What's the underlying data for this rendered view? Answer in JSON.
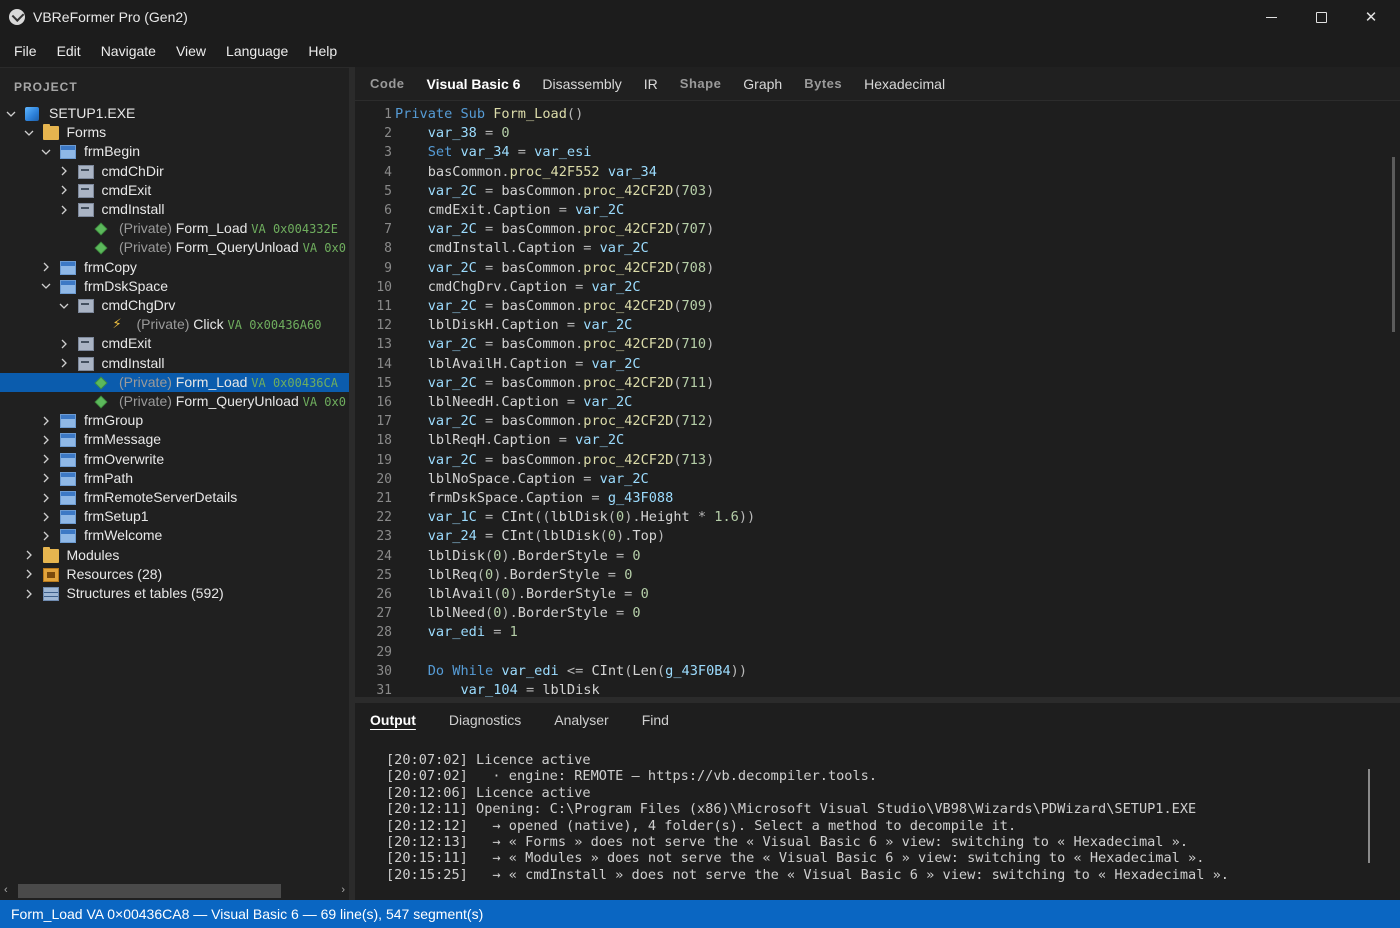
{
  "window": {
    "title": "VBReFormer Pro (Gen2)"
  },
  "menu": [
    "File",
    "Edit",
    "Navigate",
    "View",
    "Language",
    "Help"
  ],
  "project": {
    "header": "PROJECT",
    "tree": [
      {
        "label": "SETUP1.EXE",
        "icon": "exe-icon",
        "expanded": true
      },
      {
        "label": "Forms",
        "icon": "folder-icon",
        "expanded": true
      },
      {
        "label": "frmBegin",
        "icon": "form-icon",
        "expanded": true
      },
      {
        "label": "cmdChDir",
        "icon": "control-icon",
        "expanded": false
      },
      {
        "label": "cmdExit",
        "icon": "control-icon",
        "expanded": false
      },
      {
        "label": "cmdInstall",
        "icon": "control-icon",
        "expanded": false
      },
      {
        "private": "(Private)",
        "label": "Form_Load",
        "va": "VA 0x004332E",
        "icon": "method-icon"
      },
      {
        "private": "(Private)",
        "label": "Form_QueryUnload",
        "va": "VA 0x0",
        "icon": "method-icon"
      },
      {
        "label": "frmCopy",
        "icon": "form-icon",
        "expanded": false
      },
      {
        "label": "frmDskSpace",
        "icon": "form-icon",
        "expanded": true
      },
      {
        "label": "cmdChgDrv",
        "icon": "control-icon",
        "expanded": true
      },
      {
        "private": "(Private)",
        "label": "Click",
        "va": "VA 0x00436A60",
        "icon": "event-bolt-icon"
      },
      {
        "label": "cmdExit",
        "icon": "control-icon",
        "expanded": false
      },
      {
        "label": "cmdInstall",
        "icon": "control-icon",
        "expanded": false
      },
      {
        "private": "(Private)",
        "label": "Form_Load",
        "va": "VA 0x00436CA",
        "icon": "method-icon",
        "selected": true
      },
      {
        "private": "(Private)",
        "label": "Form_QueryUnload",
        "va": "VA 0x0",
        "icon": "method-icon"
      },
      {
        "label": "frmGroup",
        "icon": "form-icon",
        "expanded": false
      },
      {
        "label": "frmMessage",
        "icon": "form-icon",
        "expanded": false
      },
      {
        "label": "frmOverwrite",
        "icon": "form-icon",
        "expanded": false
      },
      {
        "label": "frmPath",
        "icon": "form-icon",
        "expanded": false
      },
      {
        "label": "frmRemoteServerDetails",
        "icon": "form-icon",
        "expanded": false
      },
      {
        "label": "frmSetup1",
        "icon": "form-icon",
        "expanded": false
      },
      {
        "label": "frmWelcome",
        "icon": "form-icon",
        "expanded": false
      },
      {
        "label": "Modules",
        "icon": "folder-icon",
        "expanded": false
      },
      {
        "label": "Resources (28)",
        "icon": "resources-icon",
        "expanded": false
      },
      {
        "label": "Structures et tables (592)",
        "icon": "structures-icon",
        "expanded": false
      }
    ]
  },
  "view_tabs": [
    {
      "label": "Code",
      "caps": true
    },
    {
      "label": "Visual Basic 6",
      "active": true
    },
    {
      "label": "Disassembly"
    },
    {
      "label": "IR"
    },
    {
      "label": "Shape",
      "caps": true
    },
    {
      "label": "Graph"
    },
    {
      "label": "Bytes",
      "caps": true
    },
    {
      "label": "Hexadecimal"
    }
  ],
  "code": {
    "lines": [
      [
        [
          "k",
          "Private Sub "
        ],
        [
          "p",
          "Form_Load"
        ],
        [
          "o",
          "()"
        ]
      ],
      [
        [
          "t",
          "    "
        ],
        [
          "v",
          "var_38"
        ],
        [
          "o",
          " = "
        ],
        [
          "n",
          "0"
        ]
      ],
      [
        [
          "t",
          "    "
        ],
        [
          "k",
          "Set "
        ],
        [
          "v",
          "var_34"
        ],
        [
          "o",
          " = "
        ],
        [
          "v",
          "var_esi"
        ]
      ],
      [
        [
          "t",
          "    basCommon"
        ],
        [
          "o",
          "."
        ],
        [
          "p",
          "proc_42F552"
        ],
        [
          "t",
          " "
        ],
        [
          "v",
          "var_34"
        ]
      ],
      [
        [
          "t",
          "    "
        ],
        [
          "v",
          "var_2C"
        ],
        [
          "o",
          " = "
        ],
        [
          "t",
          "basCommon"
        ],
        [
          "o",
          "."
        ],
        [
          "p",
          "proc_42CF2D"
        ],
        [
          "o",
          "("
        ],
        [
          "n",
          "703"
        ],
        [
          "o",
          ")"
        ]
      ],
      [
        [
          "t",
          "    cmdExit"
        ],
        [
          "o",
          "."
        ],
        [
          "t",
          "Caption"
        ],
        [
          "o",
          " = "
        ],
        [
          "v",
          "var_2C"
        ]
      ],
      [
        [
          "t",
          "    "
        ],
        [
          "v",
          "var_2C"
        ],
        [
          "o",
          " = "
        ],
        [
          "t",
          "basCommon"
        ],
        [
          "o",
          "."
        ],
        [
          "p",
          "proc_42CF2D"
        ],
        [
          "o",
          "("
        ],
        [
          "n",
          "707"
        ],
        [
          "o",
          ")"
        ]
      ],
      [
        [
          "t",
          "    cmdInstall"
        ],
        [
          "o",
          "."
        ],
        [
          "t",
          "Caption"
        ],
        [
          "o",
          " = "
        ],
        [
          "v",
          "var_2C"
        ]
      ],
      [
        [
          "t",
          "    "
        ],
        [
          "v",
          "var_2C"
        ],
        [
          "o",
          " = "
        ],
        [
          "t",
          "basCommon"
        ],
        [
          "o",
          "."
        ],
        [
          "p",
          "proc_42CF2D"
        ],
        [
          "o",
          "("
        ],
        [
          "n",
          "708"
        ],
        [
          "o",
          ")"
        ]
      ],
      [
        [
          "t",
          "    cmdChgDrv"
        ],
        [
          "o",
          "."
        ],
        [
          "t",
          "Caption"
        ],
        [
          "o",
          " = "
        ],
        [
          "v",
          "var_2C"
        ]
      ],
      [
        [
          "t",
          "    "
        ],
        [
          "v",
          "var_2C"
        ],
        [
          "o",
          " = "
        ],
        [
          "t",
          "basCommon"
        ],
        [
          "o",
          "."
        ],
        [
          "p",
          "proc_42CF2D"
        ],
        [
          "o",
          "("
        ],
        [
          "n",
          "709"
        ],
        [
          "o",
          ")"
        ]
      ],
      [
        [
          "t",
          "    lblDiskH"
        ],
        [
          "o",
          "."
        ],
        [
          "t",
          "Caption"
        ],
        [
          "o",
          " = "
        ],
        [
          "v",
          "var_2C"
        ]
      ],
      [
        [
          "t",
          "    "
        ],
        [
          "v",
          "var_2C"
        ],
        [
          "o",
          " = "
        ],
        [
          "t",
          "basCommon"
        ],
        [
          "o",
          "."
        ],
        [
          "p",
          "proc_42CF2D"
        ],
        [
          "o",
          "("
        ],
        [
          "n",
          "710"
        ],
        [
          "o",
          ")"
        ]
      ],
      [
        [
          "t",
          "    lblAvailH"
        ],
        [
          "o",
          "."
        ],
        [
          "t",
          "Caption"
        ],
        [
          "o",
          " = "
        ],
        [
          "v",
          "var_2C"
        ]
      ],
      [
        [
          "t",
          "    "
        ],
        [
          "v",
          "var_2C"
        ],
        [
          "o",
          " = "
        ],
        [
          "t",
          "basCommon"
        ],
        [
          "o",
          "."
        ],
        [
          "p",
          "proc_42CF2D"
        ],
        [
          "o",
          "("
        ],
        [
          "n",
          "711"
        ],
        [
          "o",
          ")"
        ]
      ],
      [
        [
          "t",
          "    lblNeedH"
        ],
        [
          "o",
          "."
        ],
        [
          "t",
          "Caption"
        ],
        [
          "o",
          " = "
        ],
        [
          "v",
          "var_2C"
        ]
      ],
      [
        [
          "t",
          "    "
        ],
        [
          "v",
          "var_2C"
        ],
        [
          "o",
          " = "
        ],
        [
          "t",
          "basCommon"
        ],
        [
          "o",
          "."
        ],
        [
          "p",
          "proc_42CF2D"
        ],
        [
          "o",
          "("
        ],
        [
          "n",
          "712"
        ],
        [
          "o",
          ")"
        ]
      ],
      [
        [
          "t",
          "    lblReqH"
        ],
        [
          "o",
          "."
        ],
        [
          "t",
          "Caption"
        ],
        [
          "o",
          " = "
        ],
        [
          "v",
          "var_2C"
        ]
      ],
      [
        [
          "t",
          "    "
        ],
        [
          "v",
          "var_2C"
        ],
        [
          "o",
          " = "
        ],
        [
          "t",
          "basCommon"
        ],
        [
          "o",
          "."
        ],
        [
          "p",
          "proc_42CF2D"
        ],
        [
          "o",
          "("
        ],
        [
          "n",
          "713"
        ],
        [
          "o",
          ")"
        ]
      ],
      [
        [
          "t",
          "    lblNoSpace"
        ],
        [
          "o",
          "."
        ],
        [
          "t",
          "Caption"
        ],
        [
          "o",
          " = "
        ],
        [
          "v",
          "var_2C"
        ]
      ],
      [
        [
          "t",
          "    frmDskSpace"
        ],
        [
          "o",
          "."
        ],
        [
          "t",
          "Caption"
        ],
        [
          "o",
          " = "
        ],
        [
          "v",
          "g_43F088"
        ]
      ],
      [
        [
          "t",
          "    "
        ],
        [
          "v",
          "var_1C"
        ],
        [
          "o",
          " = "
        ],
        [
          "t",
          "CInt"
        ],
        [
          "o",
          "(("
        ],
        [
          "t",
          "lblDisk"
        ],
        [
          "o",
          "("
        ],
        [
          "n",
          "0"
        ],
        [
          "o",
          ")."
        ],
        [
          "t",
          "Height"
        ],
        [
          "o",
          " * "
        ],
        [
          "n",
          "1.6"
        ],
        [
          "o",
          "))"
        ]
      ],
      [
        [
          "t",
          "    "
        ],
        [
          "v",
          "var_24"
        ],
        [
          "o",
          " = "
        ],
        [
          "t",
          "CInt"
        ],
        [
          "o",
          "("
        ],
        [
          "t",
          "lblDisk"
        ],
        [
          "o",
          "("
        ],
        [
          "n",
          "0"
        ],
        [
          "o",
          ")."
        ],
        [
          "t",
          "Top"
        ],
        [
          "o",
          ")"
        ]
      ],
      [
        [
          "t",
          "    lblDisk"
        ],
        [
          "o",
          "("
        ],
        [
          "n",
          "0"
        ],
        [
          "o",
          ")."
        ],
        [
          "t",
          "BorderStyle"
        ],
        [
          "o",
          " = "
        ],
        [
          "n",
          "0"
        ]
      ],
      [
        [
          "t",
          "    lblReq"
        ],
        [
          "o",
          "("
        ],
        [
          "n",
          "0"
        ],
        [
          "o",
          ")."
        ],
        [
          "t",
          "BorderStyle"
        ],
        [
          "o",
          " = "
        ],
        [
          "n",
          "0"
        ]
      ],
      [
        [
          "t",
          "    lblAvail"
        ],
        [
          "o",
          "("
        ],
        [
          "n",
          "0"
        ],
        [
          "o",
          ")."
        ],
        [
          "t",
          "BorderStyle"
        ],
        [
          "o",
          " = "
        ],
        [
          "n",
          "0"
        ]
      ],
      [
        [
          "t",
          "    lblNeed"
        ],
        [
          "o",
          "("
        ],
        [
          "n",
          "0"
        ],
        [
          "o",
          ")."
        ],
        [
          "t",
          "BorderStyle"
        ],
        [
          "o",
          " = "
        ],
        [
          "n",
          "0"
        ]
      ],
      [
        [
          "t",
          "    "
        ],
        [
          "v",
          "var_edi"
        ],
        [
          "o",
          " = "
        ],
        [
          "n",
          "1"
        ]
      ],
      [],
      [
        [
          "t",
          "    "
        ],
        [
          "k",
          "Do While "
        ],
        [
          "v",
          "var_edi"
        ],
        [
          "o",
          " <= "
        ],
        [
          "t",
          "CInt"
        ],
        [
          "o",
          "("
        ],
        [
          "t",
          "Len"
        ],
        [
          "o",
          "("
        ],
        [
          "v",
          "g_43F0B4"
        ],
        [
          "o",
          "))"
        ]
      ],
      [
        [
          "t",
          "        "
        ],
        [
          "v",
          "var_104"
        ],
        [
          "o",
          " = "
        ],
        [
          "t",
          "lblDisk"
        ]
      ]
    ]
  },
  "output_tabs": [
    {
      "label": "Output",
      "active": true
    },
    {
      "label": "Diagnostics"
    },
    {
      "label": "Analyser"
    },
    {
      "label": "Find"
    }
  ],
  "log": [
    "[20:07:02] Licence active",
    "[20:07:02]   · engine: REMOTE — https://vb.decompiler.tools.",
    "[20:12:06] Licence active",
    "[20:12:11] Opening: C:\\Program Files (x86)\\Microsoft Visual Studio\\VB98\\Wizards\\PDWizard\\SETUP1.EXE",
    "[20:12:12]   → opened (native), 4 folder(s). Select a method to decompile it.",
    "[20:12:13]   → « Forms » does not serve the « Visual Basic 6 » view: switching to « Hexadecimal ».",
    "[20:15:11]   → « Modules » does not serve the « Visual Basic 6 » view: switching to « Hexadecimal ».",
    "[20:15:25]   → « cmdInstall » does not serve the « Visual Basic 6 » view: switching to « Hexadecimal »."
  ],
  "status": "Form_Load  VA 0×00436CA8  —  Visual Basic 6  —  69 line(s), 547 segment(s)",
  "colors": {
    "accent": "#0a66c2",
    "selection": "#0b5cad",
    "keyword": "#569cd6",
    "va": "#6fae5e"
  }
}
